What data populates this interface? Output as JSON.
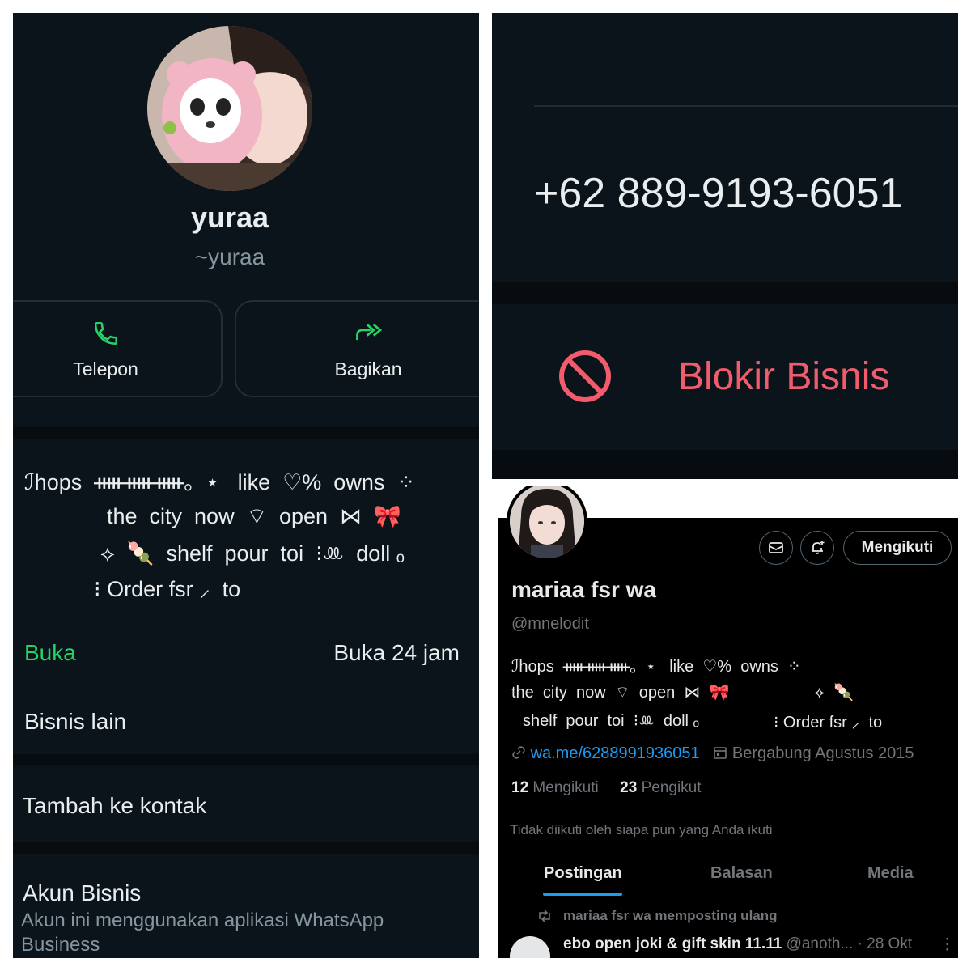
{
  "whatsapp": {
    "name": "yuraa",
    "handle": "~yuraa",
    "actions": [
      {
        "label": "Telepon",
        "icon": "phone-icon"
      },
      {
        "label": "Bagikan",
        "icon": "share-icon"
      }
    ],
    "about_lines": [
      "ℐhops  ᚔᚔᚔ。⋆   like  ♡%  owns  ⁘",
      "the  city  now  ⌔  open  ⋈  🎀",
      "⟡  🍡  shelf  pour  toi  ⁝ꔛ  doll ₒ",
      "⁝ Order fsr ⸝  to"
    ],
    "hours_label": "Buka",
    "hours_value": "Buka 24 jam",
    "other_business": "Bisnis lain",
    "add_contact": "Tambah ke kontak",
    "account_type": "Akun Bisnis",
    "account_desc": "Akun ini menggunakan aplikasi WhatsApp Business",
    "phone": "+62 889-9193-6051",
    "block_label": "Blokir Bisnis",
    "colors": {
      "accent": "#25d366",
      "danger": "#f15c6d",
      "bg": "#0b141a"
    }
  },
  "twitter": {
    "follow_button": "Mengikuti",
    "name": "mariaa fsr wa",
    "handle": "@mnelodit",
    "bio_lines": [
      "ℐhops  ᚔᚔᚔ。⋆   like  ♡%  owns  ⁘",
      "the  city  now  ⌔  open  ⋈  🎀",
      "⟡  🍡",
      "shelf  pour  toi  ⁝ꔛ  doll ₒ",
      "⁝ Order fsr ⸝  to"
    ],
    "link": "wa.me/6288991936051",
    "joined": "Bergabung Agustus 2015",
    "following_count": "12",
    "following_label": "Mengikuti",
    "followers_count": "23",
    "followers_label": "Pengikut",
    "not_followed": "Tidak diikuti oleh siapa pun yang Anda ikuti",
    "tabs": [
      "Postingan",
      "Balasan",
      "Media"
    ],
    "repost_label": "mariaa fsr wa memposting ulang",
    "post_author": "ebo open joki & gift skin 11.11",
    "post_handle": "@anoth...",
    "post_date": "· 28 Okt",
    "colors": {
      "link": "#1d9bf0",
      "bg": "#000000"
    }
  }
}
